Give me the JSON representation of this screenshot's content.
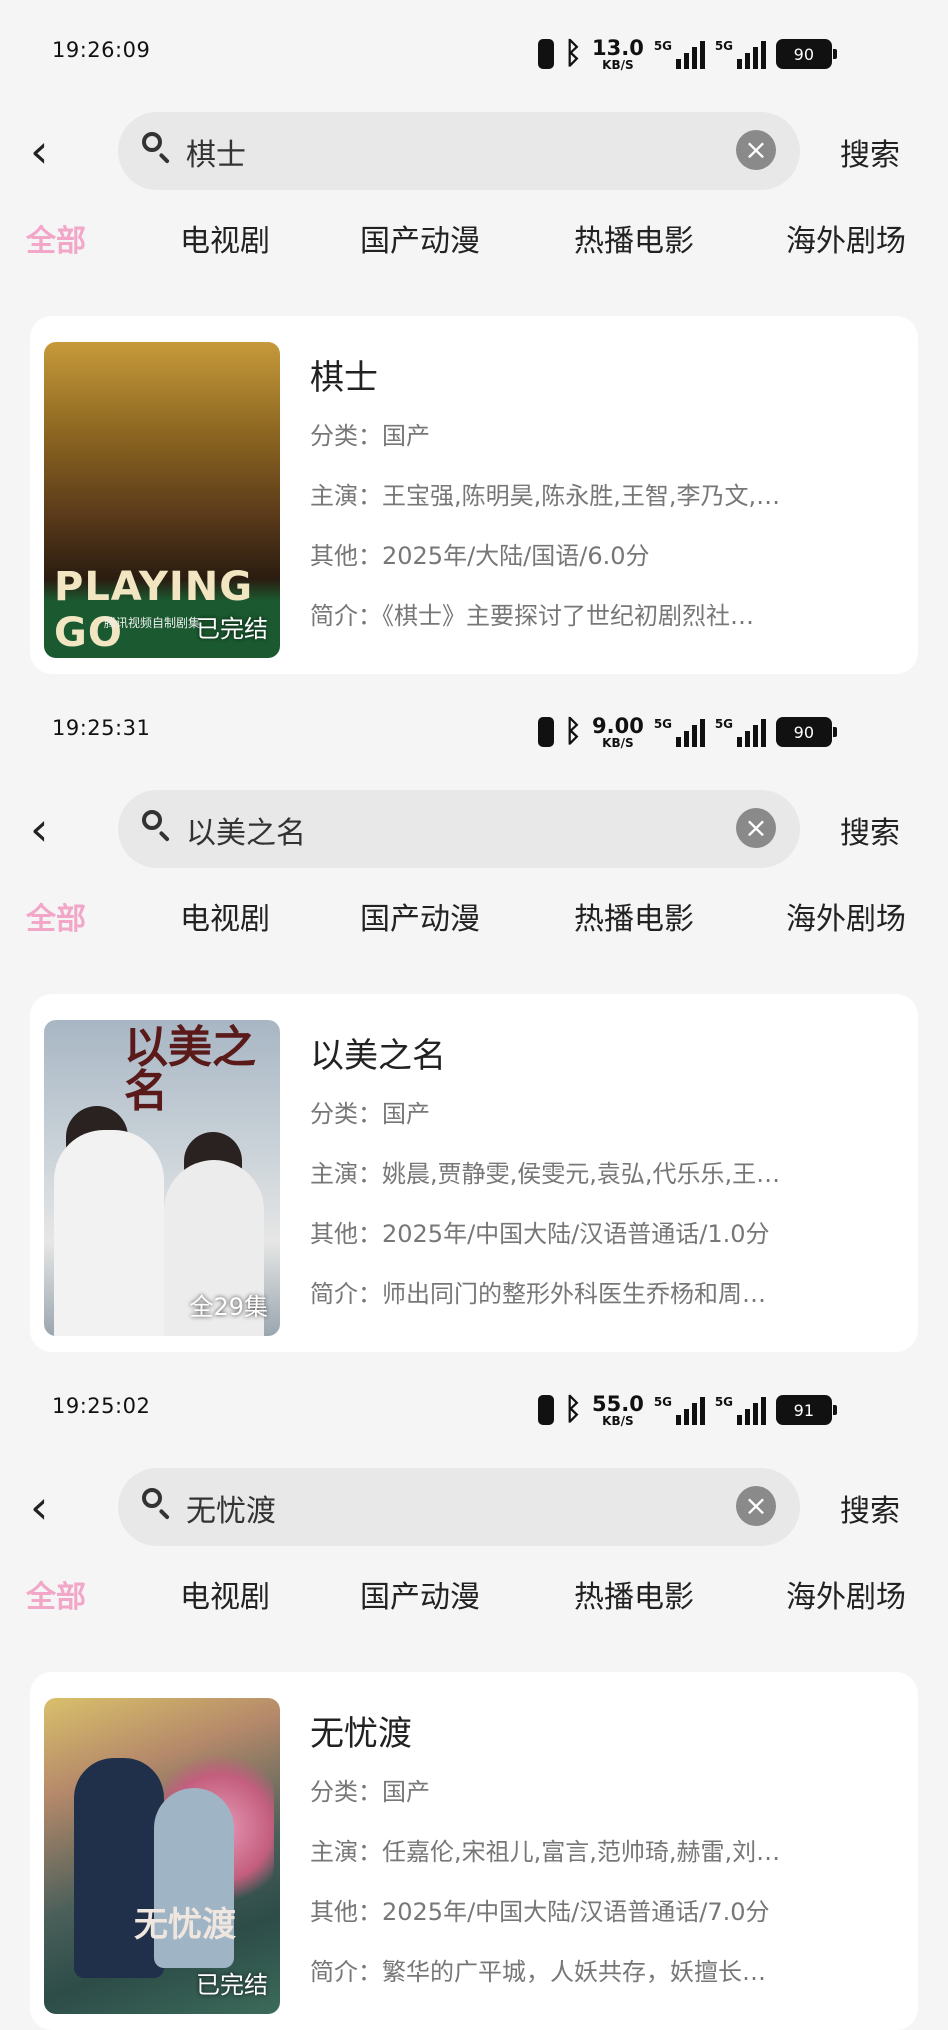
{
  "tabs": [
    "全部",
    "电视剧",
    "国产动漫",
    "热播电影",
    "海外剧场"
  ],
  "search_button": "搜索",
  "labels": {
    "category": "分类：",
    "cast": "主演：",
    "other": "其他：",
    "intro": "简介："
  },
  "screens": [
    {
      "time": "19:26:09",
      "net_speed": "13.0",
      "net_unit": "KB/S",
      "battery": "90",
      "query": "棋士",
      "result": {
        "title": "棋士",
        "category": "国产",
        "cast": "王宝强,陈明昊,陈永胜,王智,李乃文,…",
        "other": "2025年/大陆/国语/6.0分",
        "intro": "《棋士》主要探讨了世纪初剧烈社…",
        "badge": "已完结",
        "poster_text": "PLAYING GO",
        "poster_sub": "腾讯视频自制剧集"
      }
    },
    {
      "time": "19:25:31",
      "net_speed": "9.00",
      "net_unit": "KB/S",
      "battery": "90",
      "query": "以美之名",
      "result": {
        "title": "以美之名",
        "category": "国产",
        "cast": "姚晨,贾静雯,侯雯元,袁弘,代乐乐,王…",
        "other": "2025年/中国大陆/汉语普通话/1.0分",
        "intro": "师出同门的整形外科医生乔杨和周…",
        "badge": "全29集",
        "poster_text": "以美之名"
      }
    },
    {
      "time": "19:25:02",
      "net_speed": "55.0",
      "net_unit": "KB/S",
      "battery": "91",
      "query": "无忧渡",
      "result": {
        "title": "无忧渡",
        "category": "国产",
        "cast": "任嘉伦,宋祖儿,富言,范帅琦,赫雷,刘…",
        "other": "2025年/中国大陆/汉语普通话/7.0分",
        "intro": "繁华的广平城，人妖共存，妖擅长…",
        "badge": "已完结",
        "poster_text": "无忧渡"
      }
    }
  ]
}
